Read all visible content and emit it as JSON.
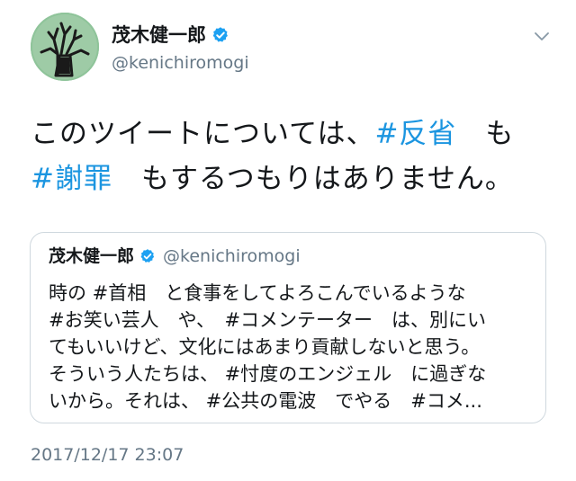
{
  "header": {
    "display_name": "茂木健一郎",
    "handle": "@kenichiromogi"
  },
  "tweet": {
    "lines": [
      [
        {
          "text": "このツイートについては、",
          "hashtag": false
        },
        {
          "text": "#反省",
          "hashtag": true
        },
        {
          "text": "　も",
          "hashtag": false
        }
      ],
      [
        {
          "text": "#謝罪",
          "hashtag": true
        },
        {
          "text": "　もするつもりはありません。",
          "hashtag": false
        }
      ]
    ]
  },
  "quoted_tweet": {
    "display_name": "茂木健一郎",
    "handle": "@kenichiromogi",
    "lines": [
      "時の #首相　と食事をしてよろこんでいるような",
      "#お笑い芸人　や、　#コメンテーター　は、別にい",
      "てもいいけど、文化にはあまり貢献しないと思う。",
      "そういう人たちは、 #忖度のエンジェル　に過ぎな",
      "いから。それは、 #公共の電波　でやる　#コメ..."
    ]
  },
  "timestamp": "2017/12/17 23:07",
  "colors": {
    "hashtag": "#1b95e0",
    "verified": "#1da1f2",
    "secondary_text": "#657786",
    "border": "#cfd8de"
  },
  "icons": {
    "verified": "verified-badge-icon",
    "menu": "chevron-down-icon",
    "avatar": "avatar-drawing"
  }
}
